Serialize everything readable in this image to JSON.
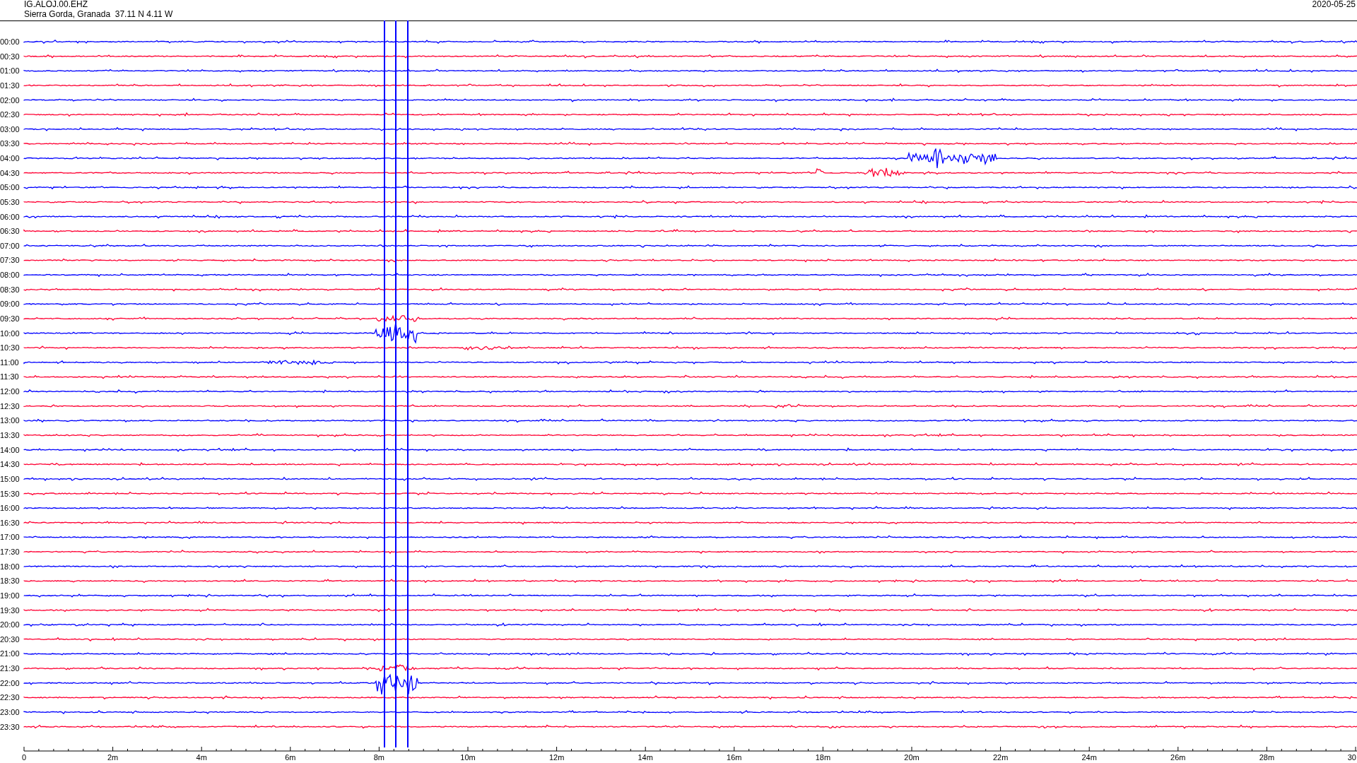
{
  "header": {
    "station": "IG.ALOJ.00.EHZ",
    "location": "Sierra Gorda, Granada  37.11 N 4.11 W",
    "date": "2020-05-25"
  },
  "rows": [
    {
      "time": "00:00",
      "color": "#0000ff"
    },
    {
      "time": "00:30",
      "color": "#ff0033"
    },
    {
      "time": "01:00",
      "color": "#0000ff"
    },
    {
      "time": "01:30",
      "color": "#ff0033"
    },
    {
      "time": "02:00",
      "color": "#0000ff"
    },
    {
      "time": "02:30",
      "color": "#ff0033"
    },
    {
      "time": "03:00",
      "color": "#0000ff"
    },
    {
      "time": "03:30",
      "color": "#ff0033"
    },
    {
      "time": "04:00",
      "color": "#0000ff"
    },
    {
      "time": "04:30",
      "color": "#ff0033"
    },
    {
      "time": "05:00",
      "color": "#0000ff"
    },
    {
      "time": "05:30",
      "color": "#ff0033"
    },
    {
      "time": "06:00",
      "color": "#0000ff"
    },
    {
      "time": "06:30",
      "color": "#ff0033"
    },
    {
      "time": "07:00",
      "color": "#0000ff"
    },
    {
      "time": "07:30",
      "color": "#ff0033"
    },
    {
      "time": "08:00",
      "color": "#0000ff"
    },
    {
      "time": "08:30",
      "color": "#ff0033"
    },
    {
      "time": "09:00",
      "color": "#0000ff"
    },
    {
      "time": "09:30",
      "color": "#ff0033"
    },
    {
      "time": "10:00",
      "color": "#0000ff"
    },
    {
      "time": "10:30",
      "color": "#ff0033"
    },
    {
      "time": "11:00",
      "color": "#0000ff"
    },
    {
      "time": "11:30",
      "color": "#ff0033"
    },
    {
      "time": "12:00",
      "color": "#0000ff"
    },
    {
      "time": "12:30",
      "color": "#ff0033"
    },
    {
      "time": "13:00",
      "color": "#0000ff"
    },
    {
      "time": "13:30",
      "color": "#ff0033"
    },
    {
      "time": "14:00",
      "color": "#0000ff"
    },
    {
      "time": "14:30",
      "color": "#ff0033"
    },
    {
      "time": "15:00",
      "color": "#0000ff"
    },
    {
      "time": "15:30",
      "color": "#ff0033"
    },
    {
      "time": "16:00",
      "color": "#0000ff"
    },
    {
      "time": "16:30",
      "color": "#ff0033"
    },
    {
      "time": "17:00",
      "color": "#0000ff"
    },
    {
      "time": "17:30",
      "color": "#ff0033"
    },
    {
      "time": "18:00",
      "color": "#0000ff"
    },
    {
      "time": "18:30",
      "color": "#ff0033"
    },
    {
      "time": "19:00",
      "color": "#0000ff"
    },
    {
      "time": "19:30",
      "color": "#ff0033"
    },
    {
      "time": "20:00",
      "color": "#0000ff"
    },
    {
      "time": "20:30",
      "color": "#ff0033"
    },
    {
      "time": "21:00",
      "color": "#0000ff"
    },
    {
      "time": "21:30",
      "color": "#ff0033"
    },
    {
      "time": "22:00",
      "color": "#0000ff"
    },
    {
      "time": "22:30",
      "color": "#ff0033"
    },
    {
      "time": "23:00",
      "color": "#0000ff"
    },
    {
      "time": "23:30",
      "color": "#ff0033"
    }
  ],
  "x_axis": {
    "ticks": [
      "0",
      "2m",
      "4m",
      "6m",
      "8m",
      "10m",
      "12m",
      "14m",
      "16m",
      "18m",
      "20m",
      "22m",
      "24m",
      "26m",
      "28m",
      "30"
    ]
  }
}
